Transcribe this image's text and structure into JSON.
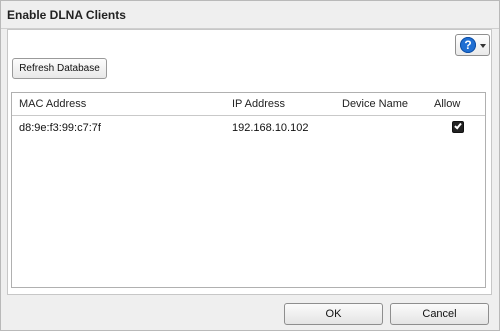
{
  "dialog": {
    "title": "Enable DLNA Clients",
    "help_icon": "question-icon",
    "refresh_label": "Refresh Database",
    "ok_label": "OK",
    "cancel_label": "Cancel"
  },
  "table": {
    "headers": [
      "MAC Address",
      "IP Address",
      "Device Name",
      "Allow"
    ],
    "rows": [
      {
        "mac": "d8:9e:f3:99:c7:7f",
        "ip": "192.168.10.102",
        "device": "",
        "allow": true
      }
    ]
  },
  "colors": {
    "help_blue": "#1f6fd3"
  }
}
